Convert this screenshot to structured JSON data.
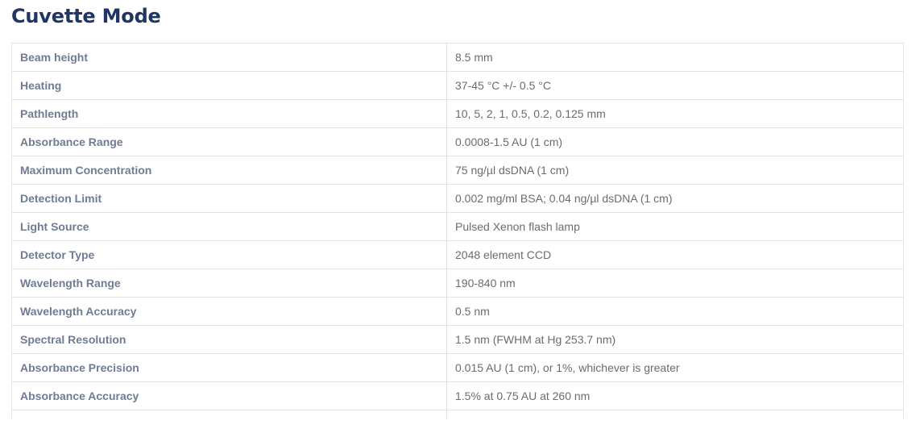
{
  "title": "Cuvette Mode",
  "specs": [
    {
      "label": "Beam height",
      "value": "8.5 mm"
    },
    {
      "label": "Heating",
      "value": "37-45 °C +/- 0.5 °C"
    },
    {
      "label": "Pathlength",
      "value": "10, 5, 2, 1, 0.5, 0.2, 0.125 mm"
    },
    {
      "label": "Absorbance Range",
      "value": "0.0008-1.5 AU (1 cm)"
    },
    {
      "label": "Maximum Concentration",
      "value": "75 ng/µl dsDNA (1 cm)"
    },
    {
      "label": "Detection Limit",
      "value": "0.002 mg/ml BSA; 0.04 ng/µl dsDNA (1 cm)"
    },
    {
      "label": "Light Source",
      "value": "Pulsed Xenon flash lamp"
    },
    {
      "label": "Detector Type",
      "value": "2048 element CCD"
    },
    {
      "label": "Wavelength Range",
      "value": "190-840 nm"
    },
    {
      "label": "Wavelength Accuracy",
      "value": "0.5 nm"
    },
    {
      "label": "Spectral Resolution",
      "value": "1.5 nm (FWHM at Hg 253.7 nm)"
    },
    {
      "label": "Absorbance Precision",
      "value": "0.015 AU (1 cm), or 1%, whichever is greater"
    },
    {
      "label": "Absorbance Accuracy",
      "value": "1.5% at 0.75 AU at 260 nm"
    }
  ],
  "colors": {
    "title": "#1f3564",
    "label": "#6f7c94",
    "value": "#6c6c6c",
    "border": "#e3e3e3"
  }
}
